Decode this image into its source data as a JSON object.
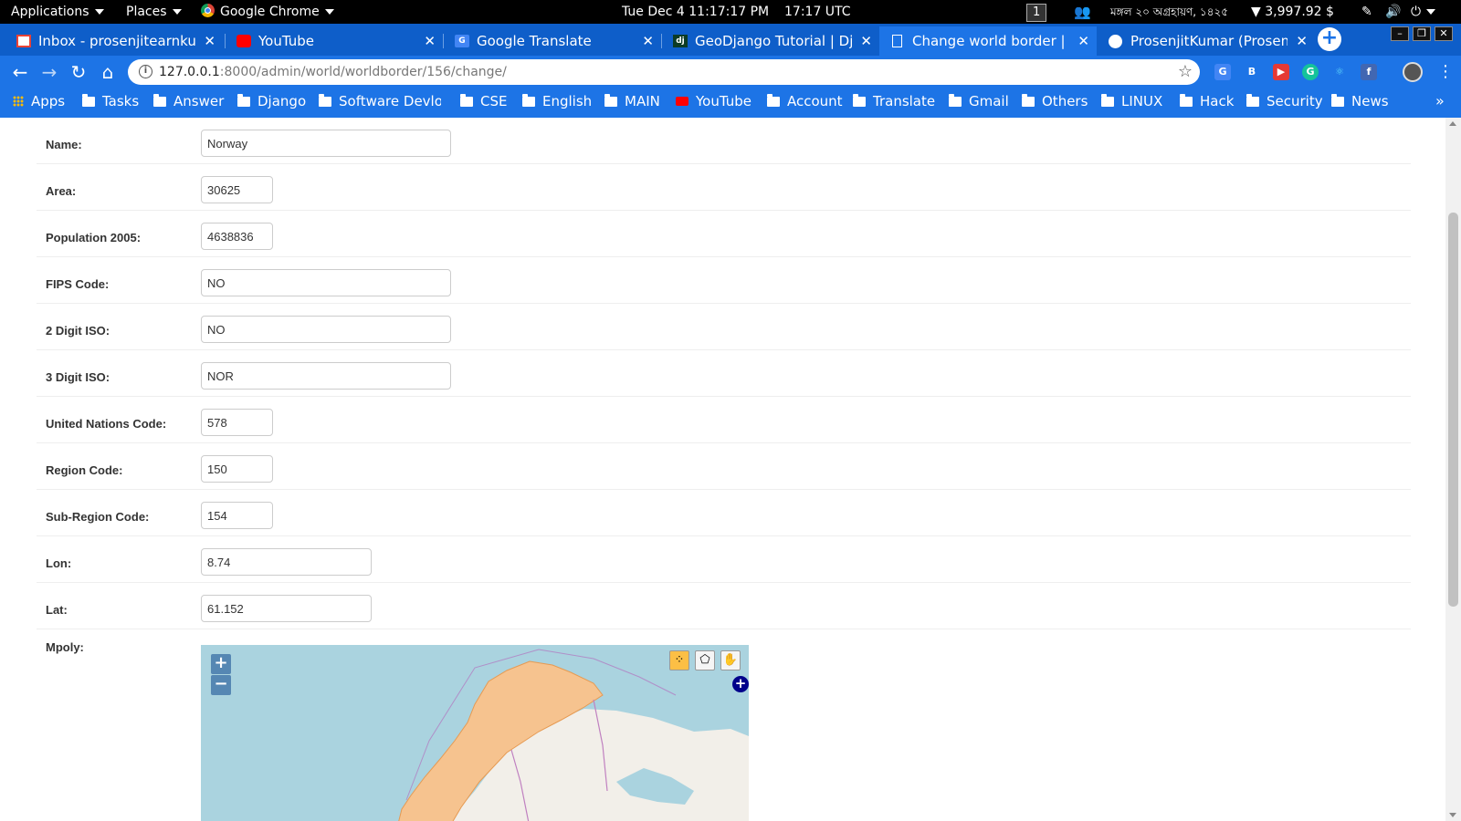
{
  "panel": {
    "applications": "Applications",
    "places": "Places",
    "active_app": "Google Chrome",
    "datetime": "Tue Dec 4  11:17:17 PM",
    "utc_time": "17:17 UTC",
    "workspace": "1",
    "bengali_date": "মঙ্গল ২০ অগ্রহায়ণ, ১৪২৫",
    "crypto_price": "3,997.92 $"
  },
  "tabs": [
    {
      "title": "Inbox - prosenjitearnkumar",
      "icon": "gmail-icon"
    },
    {
      "title": "YouTube",
      "icon": "youtube-icon"
    },
    {
      "title": "Google Translate",
      "icon": "google-translate-icon"
    },
    {
      "title": "GeoDjango Tutorial | Django",
      "icon": "django-icon"
    },
    {
      "title": "Change world border | Django",
      "icon": "page-icon"
    },
    {
      "title": "ProsenjitKumar (Prosenjit",
      "icon": "github-icon"
    }
  ],
  "address_bar": {
    "host": "127.0.0.1",
    "path": ":8000/admin/world/worldborder/156/change/"
  },
  "bookmarks": [
    "Apps",
    "Tasks",
    "Answer",
    "Django",
    "Software Devlop",
    "CSE",
    "English",
    "MAIN",
    "YouTube",
    "Account",
    "Translate",
    "Gmail",
    "Others",
    "LINUX",
    "Hack",
    "Security",
    "News"
  ],
  "form": {
    "fields": [
      {
        "label": "Name:",
        "value": "Norway"
      },
      {
        "label": "Area:",
        "value": "30625"
      },
      {
        "label": "Population 2005:",
        "value": "4638836"
      },
      {
        "label": "FIPS Code:",
        "value": "NO"
      },
      {
        "label": "2 Digit ISO:",
        "value": "NO"
      },
      {
        "label": "3 Digit ISO:",
        "value": "NOR"
      },
      {
        "label": "United Nations Code:",
        "value": "578"
      },
      {
        "label": "Region Code:",
        "value": "150"
      },
      {
        "label": "Sub-Region Code:",
        "value": "154"
      },
      {
        "label": "Lon:",
        "value": "8.74"
      },
      {
        "label": "Lat:",
        "value": "61.152"
      }
    ],
    "mpoly_label": "Mpoly:"
  },
  "map": {
    "zoom_in": "+",
    "zoom_out": "−",
    "polygon_color": "#f6c38f",
    "water_color": "#aad3df",
    "land_color": "#f2efe9"
  }
}
